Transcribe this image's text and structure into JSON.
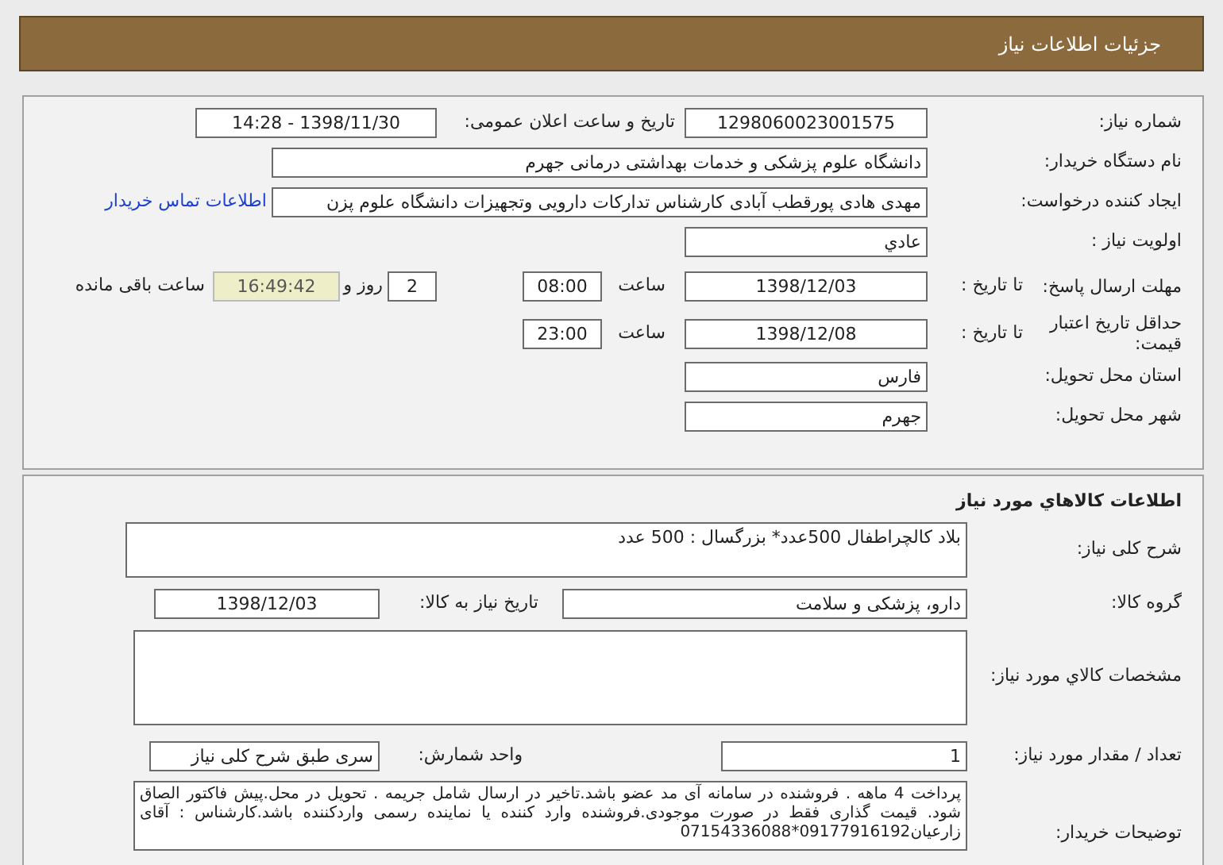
{
  "header": {
    "title": "جزئیات اطلاعات نیاز"
  },
  "need_info": {
    "need_number": {
      "label": "شماره نیاز:",
      "value": "1298060023001575"
    },
    "announce": {
      "label": "تاریخ و ساعت اعلان عمومی:",
      "value": "1398/11/30 - 14:28"
    },
    "buyer_org": {
      "label": "نام دستگاه خریدار:",
      "value": "دانشگاه علوم پزشکی و خدمات بهداشتی درمانی جهرم"
    },
    "requester": {
      "label": "ایجاد کننده درخواست:",
      "value": "مهدی هادی پورقطب آبادی کارشناس تدارکات دارویی وتجهیزات دانشگاه علوم پزن",
      "contact_link": "اطلاعات تماس خریدار"
    },
    "priority": {
      "label": "اولویت نیاز :",
      "value": "عادي"
    },
    "response_deadline": {
      "label": "مهلت ارسال پاسخ:",
      "date_label": "تا تاریخ :",
      "date": "1398/12/03",
      "time_label": "ساعت",
      "time": "08:00",
      "days": "2",
      "days_label": "روز و",
      "remaining": "16:49:42",
      "remaining_label": "ساعت باقی مانده"
    },
    "price_validity": {
      "label": "حداقل تاریخ اعتبار قیمت:",
      "date_label": "تا تاریخ :",
      "date": "1398/12/08",
      "time_label": "ساعت",
      "time": "23:00"
    },
    "province": {
      "label": "استان محل تحویل:",
      "value": "فارس"
    },
    "city": {
      "label": "شهر محل تحویل:",
      "value": "جهرم"
    }
  },
  "goods": {
    "title": "اطلاعات کالاهاي مورد نياز",
    "summary": {
      "label": "شرح کلی نیاز:",
      "value": "بلاد کالچراطفال 500عدد* بزرگسال : 500 عدد"
    },
    "group": {
      "label": "گروه کالا:",
      "value": "دارو، پزشکی و سلامت"
    },
    "need_date": {
      "label": "تاریخ نیاز به کالا:",
      "value": "1398/12/03"
    },
    "specs": {
      "label": "مشخصات کالاي مورد نیاز:"
    },
    "quantity": {
      "label": "تعداد / مقدار مورد نیاز:",
      "value": "1"
    },
    "unit": {
      "label": "واحد شمارش:",
      "value": "سری طبق شرح کلی نیاز"
    },
    "buyer_notes": {
      "label": "توضیحات خریدار:",
      "value": "پرداخت 4 ماهه . فروشنده در سامانه آی مد عضو باشد.تاخیر در ارسال شامل جریمه  . تحویل در محل.پیش فاکتور الصاق شود. قیمت گذاری فقط در صورت موجودی.فروشنده وارد کننده یا نماینده رسمی واردکننده باشد.کارشناس : آقای زارعیان09177916192*07154336088"
    }
  }
}
